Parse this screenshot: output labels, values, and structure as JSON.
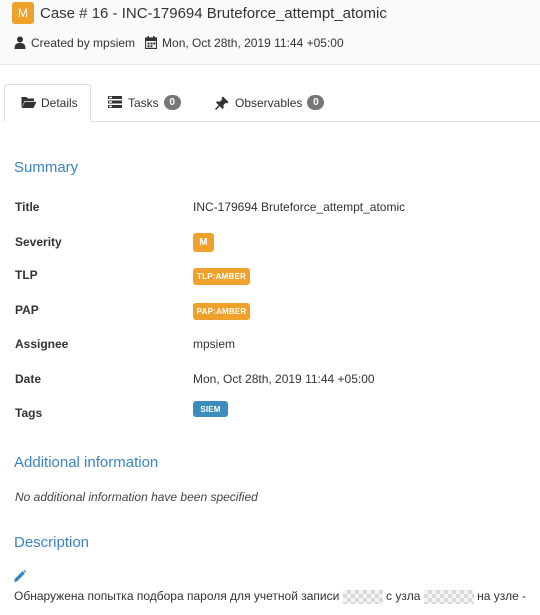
{
  "case": {
    "severity_badge": "M",
    "title": "Case # 16 - INC-179694 Bruteforce_attempt_atomic",
    "created_by": "Created by mpsiem",
    "created_date": "Mon, Oct 28th, 2019 11:44 +05:00"
  },
  "tabs": [
    {
      "label": "Details",
      "icon": "folder-open-icon"
    },
    {
      "label": "Tasks",
      "icon": "tasks-icon",
      "count": "0"
    },
    {
      "label": "Observables",
      "icon": "pushpin-icon",
      "count": "0"
    }
  ],
  "summary": {
    "heading": "Summary",
    "title_label": "Title",
    "title_value": "INC-179694 Bruteforce_attempt_atomic",
    "severity_label": "Severity",
    "severity_value": "M",
    "tlp_label": "TLP",
    "tlp_value": "TLP:AMBER",
    "pap_label": "PAP",
    "pap_value": "PAP:AMBER",
    "assignee_label": "Assignee",
    "assignee_value": "mpsiem",
    "date_label": "Date",
    "date_value": "Mon, Oct 28th, 2019 11:44 +05:00",
    "tags_label": "Tags",
    "tags": [
      "SIEM"
    ]
  },
  "additional": {
    "heading": "Additional information",
    "note": "No additional information have been specified"
  },
  "description": {
    "heading": "Description",
    "text_part1": "Обнаружена попытка подбора пароля для учетной записи",
    "text_part2": "с узла",
    "text_part3": "на узле -"
  },
  "colors": {
    "amber": "#f0a12b",
    "siem_tag": "#3c8dbc",
    "heading_blue": "#3a84c4",
    "count_badge": "#777777"
  }
}
